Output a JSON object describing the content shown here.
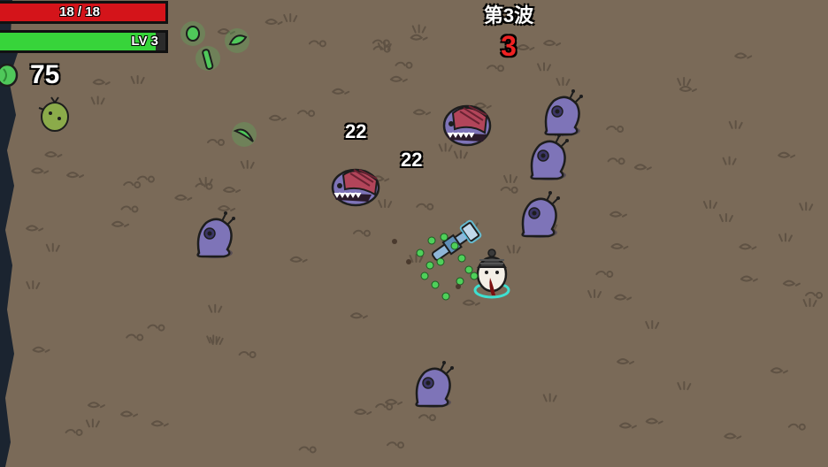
{
  "hud": {
    "hp_text": "18 / 18",
    "hp_fraction": 1.0,
    "level_text": "LV 3",
    "xp_fraction": 0.94,
    "materials_count": "75",
    "wave_label": "第3波",
    "wave_timer": "3"
  },
  "damage_numbers": [
    "22",
    "22"
  ],
  "colors": {
    "ground": "#7a6a58",
    "hp": "#d4141a",
    "xp": "#37d43a",
    "material": "#4fc85a",
    "alien": "#7e74b8",
    "timer": "#ee2222"
  },
  "entities": {
    "player": "potato-player",
    "aliens": "purple-baby-alien",
    "chargers": "red-helmet-charger",
    "tree": "green-tree-spawner",
    "weapon": "blue-wrench"
  }
}
